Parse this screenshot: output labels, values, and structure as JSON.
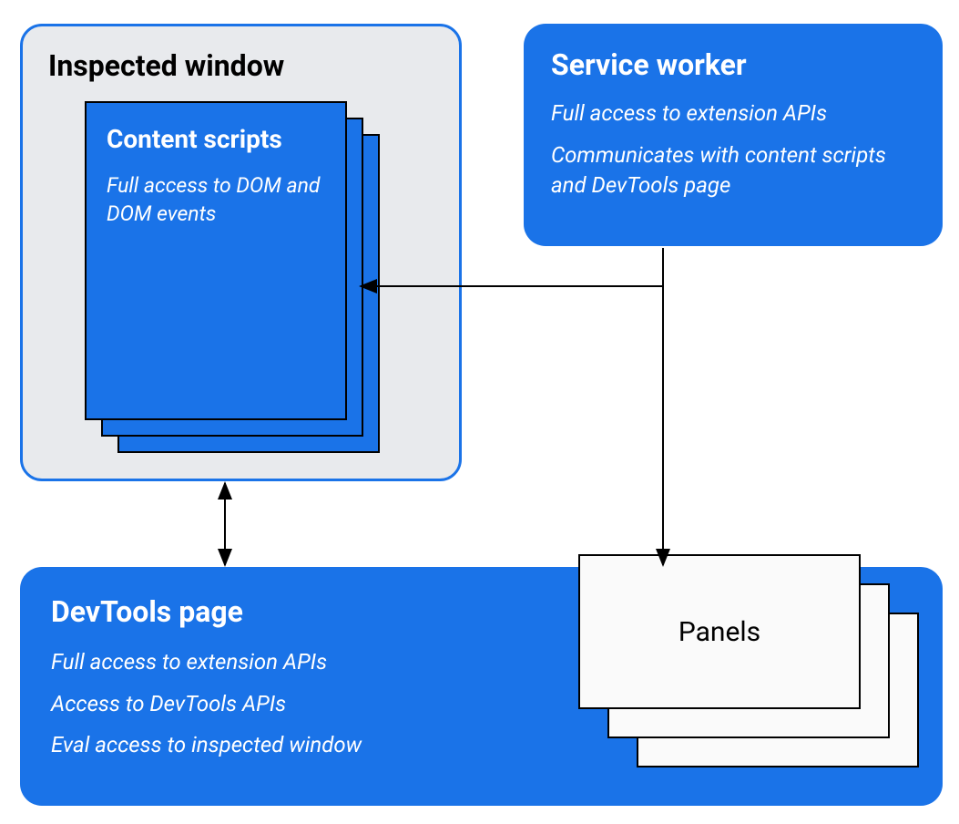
{
  "inspectedWindow": {
    "title": "Inspected window",
    "contentScripts": {
      "title": "Content scripts",
      "desc": "Full access to DOM and DOM events"
    }
  },
  "serviceWorker": {
    "title": "Service worker",
    "desc1": "Full access to extension APIs",
    "desc2": "Communicates with content scripts and DevTools page"
  },
  "devtoolsPage": {
    "title": "DevTools page",
    "desc1": "Full access to extension APIs",
    "desc2": "Access to DevTools APIs",
    "desc3": "Eval access to inspected window",
    "panelsLabel": "Panels"
  }
}
